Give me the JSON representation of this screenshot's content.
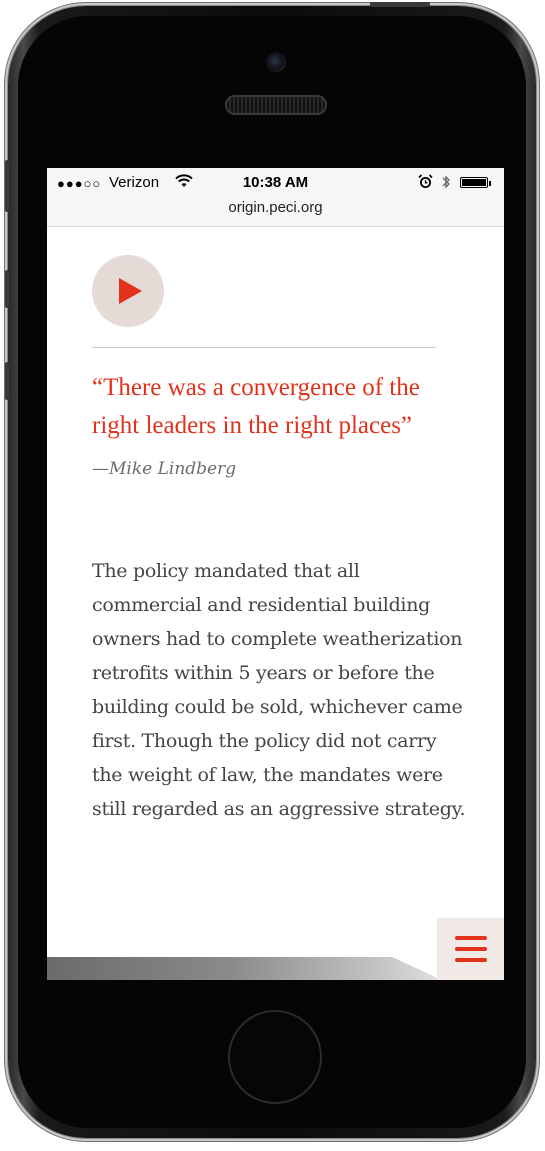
{
  "status_bar": {
    "signal": "●●●○○",
    "carrier": "Verizon",
    "time": "10:38 AM",
    "url": "origin.peci.org"
  },
  "content": {
    "quote": "“There was a convergence of the right leaders in the right places”",
    "attribution": "—Mike Lindberg",
    "body": "The policy mandated that all commercial and residential building owners had to complete weatherization retrofits within 5 years or before the building could be sold, whichever came first. Though the policy did not carry the weight of law, the mandates were still regarded as an aggressive strategy."
  },
  "icons": {
    "play": "play-icon",
    "menu": "hamburger-menu-icon",
    "wifi": "wifi-icon",
    "alarm": "alarm-icon",
    "bluetooth": "bluetooth-icon",
    "battery": "battery-icon"
  },
  "colors": {
    "accent": "#e2321c",
    "play_bg": "#e5dad6",
    "menu_bg": "#f1e9e6",
    "body_text": "#444444",
    "attribution": "#6d6d6d"
  }
}
